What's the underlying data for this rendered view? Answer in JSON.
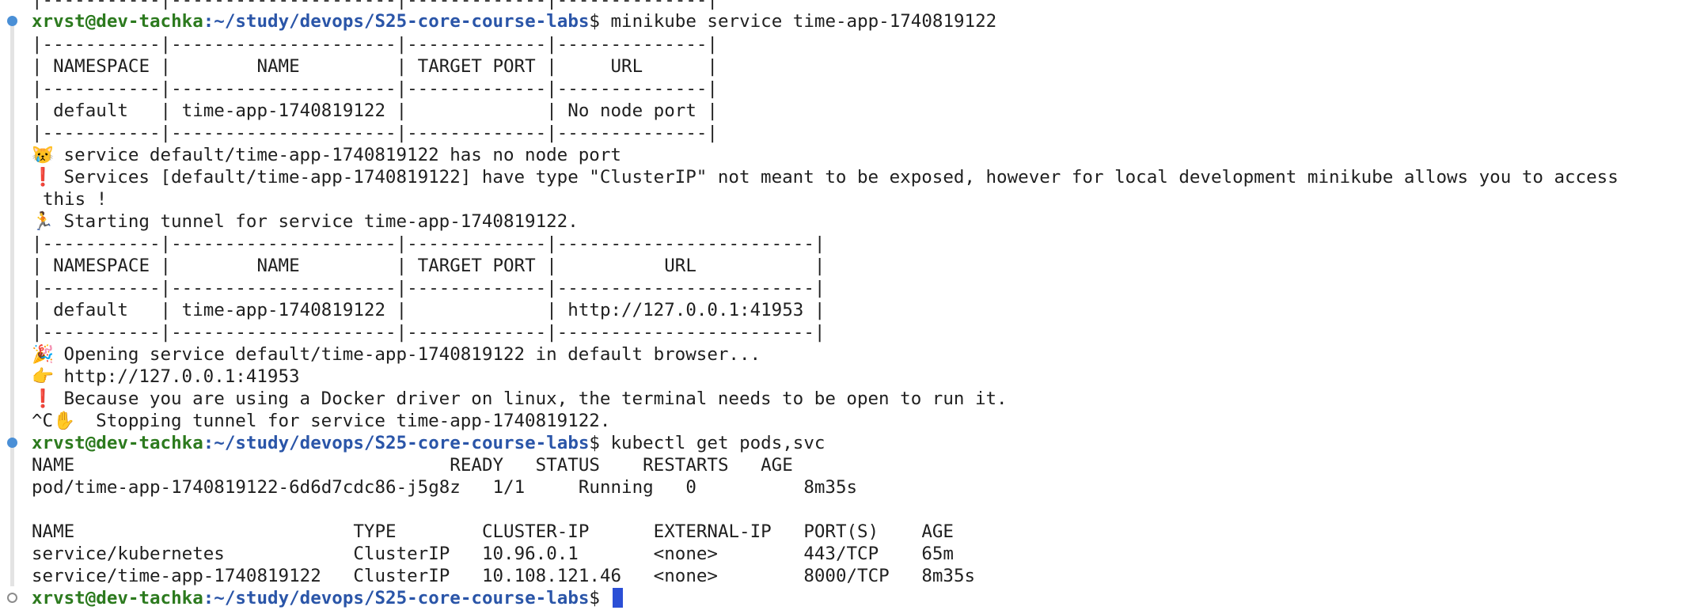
{
  "terminal": {
    "top_table_border": "|-----------|---------------------|-------------|--------------|",
    "prompt": {
      "user_host": "xrvst@dev-tachka",
      "separator": ":",
      "path": "~/study/devops/S25-core-course-labs",
      "symbol": "$"
    },
    "commands": {
      "cmd1": "minikube service time-app-1740819122",
      "cmd2": "kubectl get pods,svc",
      "cmd3": ""
    },
    "table1": [
      "|-----------|---------------------|-------------|--------------|",
      "| NAMESPACE |        NAME         | TARGET PORT |     URL      |",
      "|-----------|---------------------|-------------|--------------|",
      "| default   | time-app-1740819122 |             | No node port |",
      "|-----------|---------------------|-------------|--------------|"
    ],
    "msg_no_node_port": {
      "icon": "😿",
      "text": " service default/time-app-1740819122 has no node port"
    },
    "msg_clusterip": {
      "icon": "❗",
      "text": " Services [default/time-app-1740819122] have type \"ClusterIP\" not meant to be exposed, however for local development minikube allows you to access"
    },
    "msg_clusterip_wrap": "this !",
    "msg_tunnel": {
      "icon": "🏃",
      "text": " Starting tunnel for service time-app-1740819122."
    },
    "table2": [
      "|-----------|---------------------|-------------|------------------------|",
      "| NAMESPACE |        NAME         | TARGET PORT |          URL           |",
      "|-----------|---------------------|-------------|------------------------|",
      "| default   | time-app-1740819122 |             | http://127.0.0.1:41953 |",
      "|-----------|---------------------|-------------|------------------------|"
    ],
    "msg_opening": {
      "icon": "🎉",
      "text": " Opening service default/time-app-1740819122 in default browser..."
    },
    "msg_url": {
      "icon": "👉",
      "text": " http://127.0.0.1:41953"
    },
    "msg_docker": {
      "icon": "❗",
      "text": " Because you are using a Docker driver on linux, the terminal needs to be open to run it."
    },
    "msg_stopping": {
      "prefix": "^C",
      "icon": "✋",
      "text": "  Stopping tunnel for service time-app-1740819122."
    },
    "pods_header": "NAME                                   READY   STATUS    RESTARTS   AGE",
    "pods_rows": [
      "pod/time-app-1740819122-6d6d7cdc86-j5g8z   1/1     Running   0          8m35s"
    ],
    "svc_header": "NAME                          TYPE        CLUSTER-IP      EXTERNAL-IP   PORT(S)    AGE",
    "svc_rows": [
      "service/kubernetes            ClusterIP   10.96.0.1       <none>        443/TCP    65m",
      "service/time-app-1740819122   ClusterIP   10.108.121.46   <none>        8000/TCP   8m35s"
    ]
  }
}
